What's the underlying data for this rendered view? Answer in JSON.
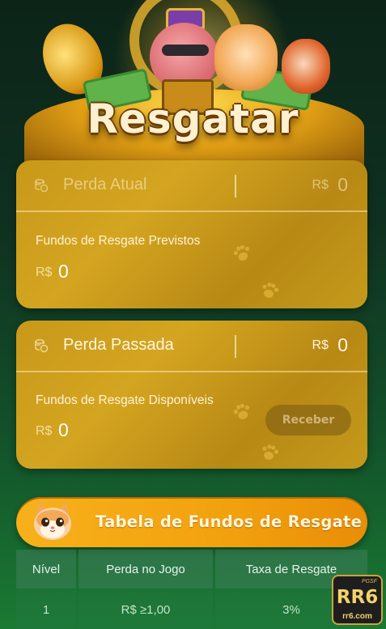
{
  "header": {
    "title": "Resgatar"
  },
  "current_loss_card": {
    "icon": "coins-icon",
    "label": "Perda Atual",
    "currency": "R$",
    "amount": "0",
    "expected_label": "Fundos de Resgate Previstos",
    "expected_currency": "R$",
    "expected_amount": "0"
  },
  "past_loss_card": {
    "icon": "coins-icon",
    "label": "Perda Passada",
    "currency": "R$",
    "amount": "0",
    "available_label": "Fundos de Resgate Disponíveis",
    "available_currency": "R$",
    "available_amount": "0",
    "claim_button_label": "Receber"
  },
  "table_banner": {
    "title": "Tabela de Fundos de Resgate",
    "icon": "cat-face-icon"
  },
  "rescue_table": {
    "columns": [
      "Nível",
      "Perda no Jogo",
      "Taxa de Resgate"
    ],
    "rows": [
      [
        "1",
        "R$ ≥1,00",
        "3%"
      ]
    ]
  },
  "watermark": {
    "tag": "PGSF",
    "brand": "RR6",
    "domain": "rr6.com"
  },
  "colors": {
    "card_gold": "#c8981a",
    "banner_orange": "#f2a10e",
    "background_green": "#13522a"
  }
}
